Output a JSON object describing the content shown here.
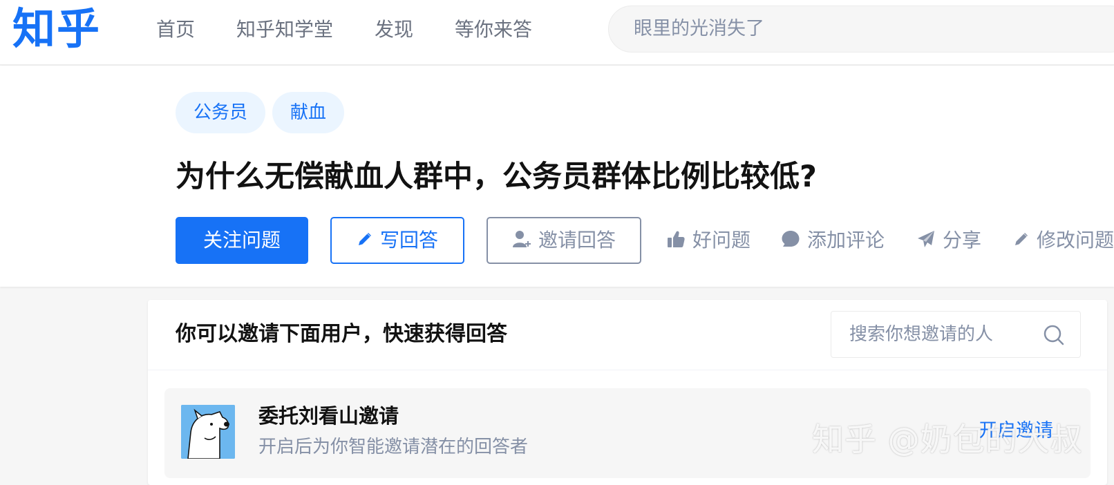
{
  "header": {
    "logo": "知乎",
    "nav": [
      "首页",
      "知乎知学堂",
      "发现",
      "等你来答"
    ],
    "search_placeholder": "眼里的光消失了"
  },
  "question": {
    "tags": [
      "公务员",
      "献血"
    ],
    "title": "为什么无偿献血人群中，公务员群体比例比较低?",
    "buttons": {
      "follow": "关注问题",
      "write": "写回答",
      "invite": "邀请回答"
    },
    "actions": {
      "good_question": "好问题",
      "comment": "添加评论",
      "share": "分享",
      "edit": "修改问题"
    },
    "icons": {
      "write": "pencil-icon",
      "invite": "add-user-icon",
      "good_question": "thumbs-up-icon",
      "comment": "comment-bubble-icon",
      "share": "paper-plane-icon",
      "edit": "pencil-icon"
    }
  },
  "invite_panel": {
    "title": "你可以邀请下面用户，快速获得回答",
    "search_placeholder": "搜索你想邀请的人",
    "delegate": {
      "title": "委托刘看山邀请",
      "description": "开启后为你智能邀请潜在的回答者",
      "button": "开启邀请"
    }
  },
  "watermark": "知乎 @奶包的大叔",
  "colors": {
    "brand": "#1772f6",
    "tag_bg": "#ebf5ff",
    "muted_text": "#8590a6",
    "page_bg": "#f6f6f6"
  }
}
